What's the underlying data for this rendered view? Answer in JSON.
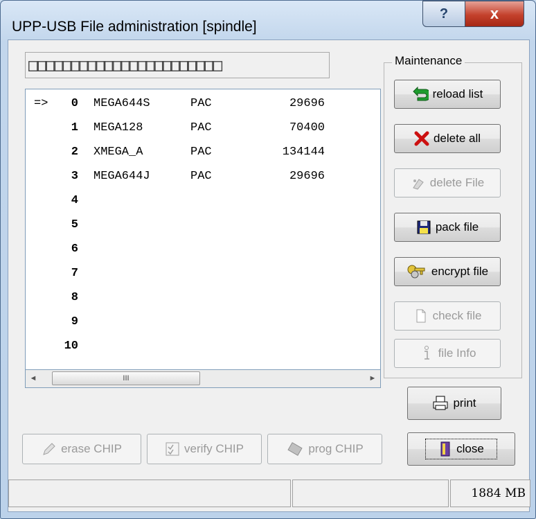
{
  "window": {
    "title": "UPP-USB File administration [spindle]",
    "help_glyph": "?",
    "close_glyph": "x"
  },
  "name_field": {
    "value": "□□□□□□□□□□□□□□□□□□□□□□□"
  },
  "file_list": {
    "rows": [
      {
        "pointer": "=>",
        "index": "0",
        "name": "MEGA644S",
        "type": "PAC",
        "size": "29696"
      },
      {
        "pointer": "",
        "index": "1",
        "name": "MEGA128",
        "type": "PAC",
        "size": "70400"
      },
      {
        "pointer": "",
        "index": "2",
        "name": "XMEGA_A",
        "type": "PAC",
        "size": "134144"
      },
      {
        "pointer": "",
        "index": "3",
        "name": "MEGA644J",
        "type": "PAC",
        "size": "29696"
      },
      {
        "pointer": "",
        "index": "4",
        "name": "",
        "type": "",
        "size": ""
      },
      {
        "pointer": "",
        "index": "5",
        "name": "",
        "type": "",
        "size": ""
      },
      {
        "pointer": "",
        "index": "6",
        "name": "",
        "type": "",
        "size": ""
      },
      {
        "pointer": "",
        "index": "7",
        "name": "",
        "type": "",
        "size": ""
      },
      {
        "pointer": "",
        "index": "8",
        "name": "",
        "type": "",
        "size": ""
      },
      {
        "pointer": "",
        "index": "9",
        "name": "",
        "type": "",
        "size": ""
      },
      {
        "pointer": "",
        "index": "10",
        "name": "",
        "type": "",
        "size": ""
      }
    ],
    "scroll": {
      "left": "◄",
      "right": "►",
      "grip": "III"
    }
  },
  "maintenance": {
    "title": "Maintenance",
    "reload_list": "reload list",
    "delete_all": "delete all",
    "delete_file": "delete File",
    "pack_file": "pack file",
    "encrypt_file": "encrypt file",
    "check_file": "check file",
    "file_info": "file Info"
  },
  "actions": {
    "print": "print",
    "erase_chip": "erase CHIP",
    "verify_chip": "verify CHIP",
    "prog_chip": "prog CHIP",
    "close": "close"
  },
  "statusbar": {
    "segment1": "",
    "segment2": "",
    "memory": "1884 MB"
  },
  "icons": {
    "reload": "reload-arrow-icon",
    "delete_all": "red-x-icon",
    "delete_file": "eraser-icon",
    "pack": "floppy-disk-icon",
    "encrypt": "keys-icon",
    "check": "document-icon",
    "info": "info-icon",
    "print": "printer-icon",
    "erase": "pen-icon",
    "verify": "checklist-icon",
    "prog": "chip-icon",
    "close": "door-icon"
  },
  "colors": {
    "title_close": "#c4412c",
    "delete_x": "#cc1010",
    "reload_green": "#1e9c2e"
  }
}
